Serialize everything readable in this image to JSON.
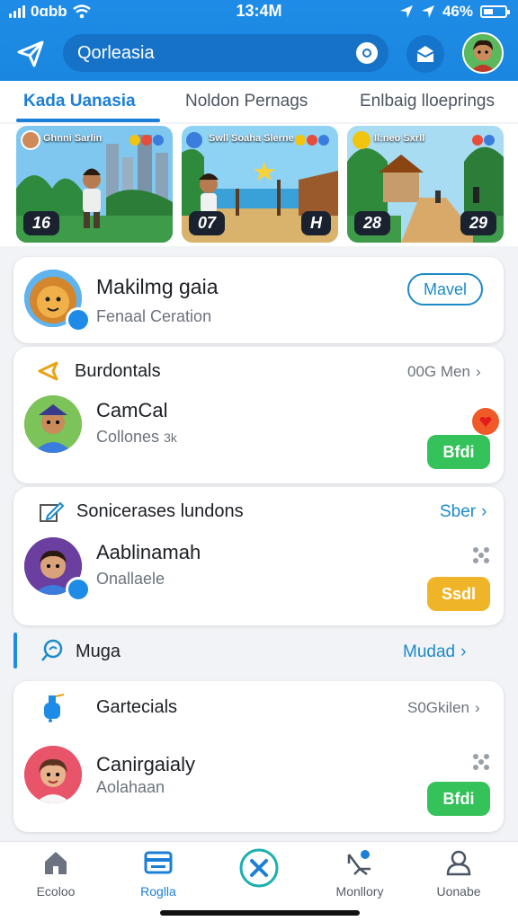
{
  "status": {
    "carrier": "0ɑbb",
    "time": "13:4M",
    "battery": "46%"
  },
  "search": {
    "placeholder": "Qorleasia"
  },
  "tabs": [
    {
      "label": "Kada Uanasia"
    },
    {
      "label": "Noldon Pernags"
    },
    {
      "label": "Enlbaig lloeprings"
    }
  ],
  "thumbnails": [
    {
      "caption": "Ghnni Sarlin",
      "badge": "16",
      "badge2": ""
    },
    {
      "caption": "Swll Soaha Slerne",
      "badge": "07",
      "badge2": "H"
    },
    {
      "caption": "Il:neo Sxrll",
      "badge": "28",
      "badge2": "29"
    }
  ],
  "featured": {
    "name": "Makilmg gaia",
    "subtitle": "Fenaal Ceration",
    "button": "Mavel",
    "avatar_icon": "lion-avatar"
  },
  "section1": {
    "title": "Burdontals",
    "meta": "00G Men",
    "user_name": "CamCal",
    "user_sub": "Collones",
    "user_sub_extra": "3k",
    "button": "Bfdi",
    "notif_icon": "heart-icon"
  },
  "section2": {
    "title": "Sonicerases lundons",
    "link": "Sber",
    "user_name": "Aablinamah",
    "user_sub": "Onallaele",
    "button": "Ssdl"
  },
  "section3": {
    "title": "Muga",
    "link": "Mudad"
  },
  "section4": {
    "title": "Gartecials",
    "meta": "S0Gkilen",
    "user_name": "Canirgaialy",
    "user_sub": "Aolahaan",
    "button": "Bfdi"
  },
  "nav": [
    {
      "label": "Ecoloo",
      "icon": "home-icon"
    },
    {
      "label": "Roglla",
      "icon": "card-icon"
    },
    {
      "label": "",
      "icon": "close-circle-icon"
    },
    {
      "label": "Monllory",
      "icon": "network-icon"
    },
    {
      "label": "Uonabe",
      "icon": "user-icon"
    }
  ],
  "colors": {
    "primary": "#1e8ce6",
    "accent_link": "#1c8ac8",
    "green": "#35c25a",
    "orange": "#f0b429",
    "alert": "#f05a28"
  }
}
